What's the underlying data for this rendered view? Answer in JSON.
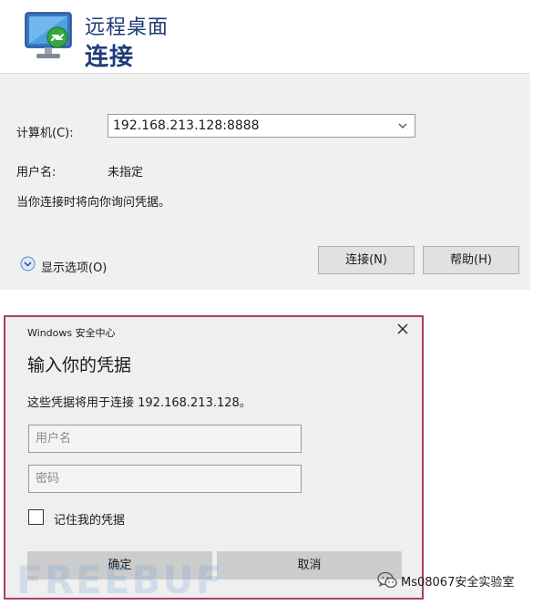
{
  "rdp": {
    "title_top": "远程桌面",
    "title_main": "连接",
    "computer_label": "计算机(C):",
    "computer_value": "192.168.213.128:8888",
    "user_label": "用户名:",
    "user_value": "未指定",
    "note": "当你连接时将向你询问凭据。",
    "show_options": "显示选项(O)",
    "connect_button": "连接(N)",
    "help_button": "帮助(H)",
    "accent_color": "#1e3c78"
  },
  "security": {
    "window_title": "Windows 安全中心",
    "heading": "输入你的凭据",
    "description": "这些凭据将用于连接 192.168.213.128。",
    "username_placeholder": "用户名",
    "password_placeholder": "密码",
    "remember_label": "记住我的凭据",
    "remember_checked": false,
    "ok_button": "确定",
    "cancel_button": "取消",
    "border_color": "#a93c73"
  },
  "watermarks": {
    "site": "FREEBUF",
    "account": "Ms08067安全实验室"
  }
}
